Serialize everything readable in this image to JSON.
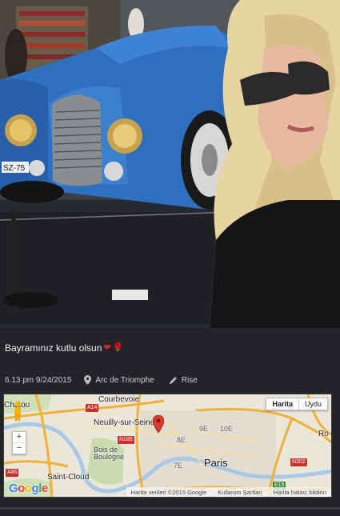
{
  "caption": {
    "text": "Bayramınız kutlu olsun",
    "emoji": [
      "heart",
      "rose"
    ]
  },
  "meta": {
    "datetime": "6.13 pm 9/24/2015",
    "location": "Arc de Triomphe",
    "filter": "Rise",
    "location_icon": "map-marker-icon",
    "filter_icon": "pencil-icon"
  },
  "map": {
    "map_type_options": [
      "Harita",
      "Uydu"
    ],
    "selected_map_type": "Harita",
    "zoom_in": "+",
    "zoom_out": "−",
    "labels": {
      "courbevoie": "Courbevoie",
      "chatou": "Chatou",
      "neuilly": "Neuilly-sur-Seine",
      "bois": "Bois de\nBoulogne",
      "paris": "Paris",
      "saint_cloud": "Saint-Cloud",
      "arr_8e": "8E",
      "arr_9e": "9E",
      "arr_10e": "10E",
      "arr_7e": "7E",
      "ro": "Ro"
    },
    "road_shields": {
      "a14": "A14",
      "n185": "N185",
      "a86": "A86",
      "n302": "N302",
      "e15": "E15"
    },
    "attribution": {
      "data": "Harita verileri ©2015 Google",
      "terms": "Kullanım Şartları",
      "report": "Harita hatası bildirin"
    },
    "logo": "Google"
  },
  "colors": {
    "background": "#222427",
    "map_land": "#e8e4d8",
    "highway": "#f2b134",
    "pin": "#d93a2f"
  }
}
